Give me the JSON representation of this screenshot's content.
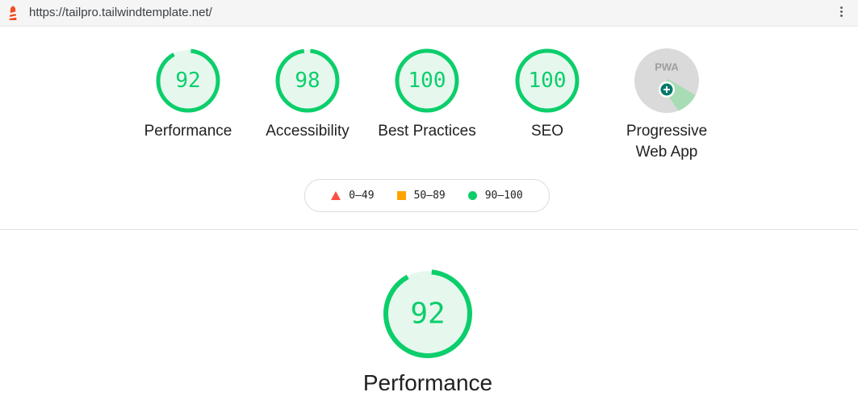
{
  "browser": {
    "url": "https://tailpro.tailwindtemplate.net/"
  },
  "categories": [
    {
      "id": "performance",
      "score": "92",
      "label": "Performance",
      "fraction": 0.92
    },
    {
      "id": "accessibility",
      "score": "98",
      "label": "Accessibility",
      "fraction": 0.98
    },
    {
      "id": "best-practices",
      "score": "100",
      "label": "Best Practices",
      "fraction": 1.0
    },
    {
      "id": "seo",
      "score": "100",
      "label": "SEO",
      "fraction": 1.0
    }
  ],
  "pwa": {
    "badge": "PWA",
    "label_line1": "Progressive",
    "label_line2": "Web App"
  },
  "legend": [
    {
      "symbol": "triangle",
      "range": "0–49",
      "color": "#ff4e42"
    },
    {
      "symbol": "square",
      "range": "50–89",
      "color": "#ffa400"
    },
    {
      "symbol": "circle",
      "range": "90–100",
      "color": "#0cce6b"
    }
  ],
  "focus": {
    "score": "92",
    "label": "Performance",
    "fraction": 0.92
  },
  "colors": {
    "pass": "#0cce6b",
    "pass_bg": "#e6f8ee",
    "average": "#ffa400",
    "fail": "#ff4e42"
  }
}
